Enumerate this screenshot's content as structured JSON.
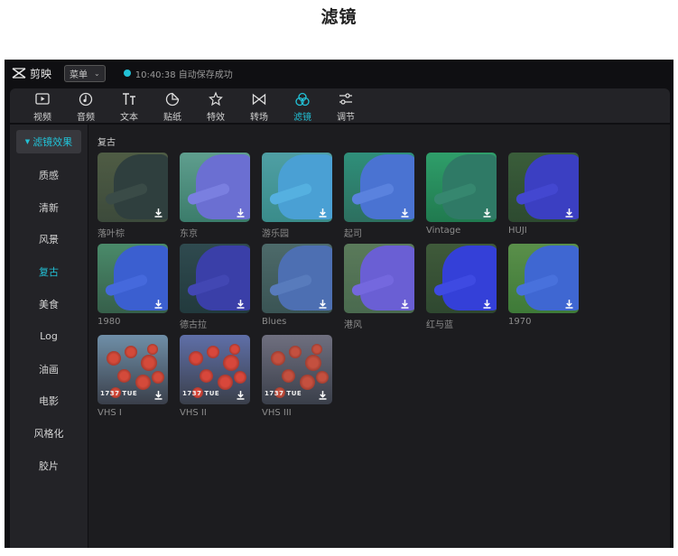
{
  "page_heading": "滤镜",
  "app": {
    "name": "剪映",
    "menu_label": "菜单",
    "save_status": "10:40:38 自动保存成功"
  },
  "toolbar": {
    "tools": [
      {
        "label": "视频",
        "icon": "video-icon"
      },
      {
        "label": "音频",
        "icon": "audio-icon"
      },
      {
        "label": "文本",
        "icon": "text-icon"
      },
      {
        "label": "贴纸",
        "icon": "sticker-icon"
      },
      {
        "label": "特效",
        "icon": "effects-icon"
      },
      {
        "label": "转场",
        "icon": "transition-icon"
      },
      {
        "label": "滤镜",
        "icon": "filter-icon",
        "active": true
      },
      {
        "label": "调节",
        "icon": "adjust-icon"
      }
    ]
  },
  "sidebar": {
    "header": "滤镜效果",
    "items": [
      "质感",
      "清新",
      "风景",
      "复古",
      "美食",
      "Log",
      "油画",
      "电影",
      "风格化",
      "胶片"
    ],
    "active_item": "复古"
  },
  "main": {
    "section_title": "复古",
    "filters": [
      {
        "label": "落叶棕",
        "style": "brown"
      },
      {
        "label": "东京",
        "style": "violet"
      },
      {
        "label": "游乐园",
        "style": "cyan"
      },
      {
        "label": "起司",
        "style": "teal"
      },
      {
        "label": "Vintage",
        "style": "green"
      },
      {
        "label": "HUJI",
        "style": "deepblue"
      },
      {
        "label": "1980",
        "style": "blue"
      },
      {
        "label": "德古拉",
        "style": "dark"
      },
      {
        "label": "Blues",
        "style": "grayblue"
      },
      {
        "label": "港风",
        "style": "pinkish"
      },
      {
        "label": "红与蓝",
        "style": "redblue"
      },
      {
        "label": "1970",
        "style": "warmgreen"
      },
      {
        "label": "VHS I",
        "style": "vhs1",
        "overlay_text": "1737 TUE"
      },
      {
        "label": "VHS II",
        "style": "vhs2",
        "overlay_text": "1737 TUE"
      },
      {
        "label": "VHS III",
        "style": "vhs3",
        "overlay_text": "1737 TUE"
      }
    ]
  },
  "colors": {
    "accent": "#22c1d6",
    "app_bg": "#0f0f12",
    "panel_bg": "#232327",
    "content_bg": "#1c1c1f"
  }
}
